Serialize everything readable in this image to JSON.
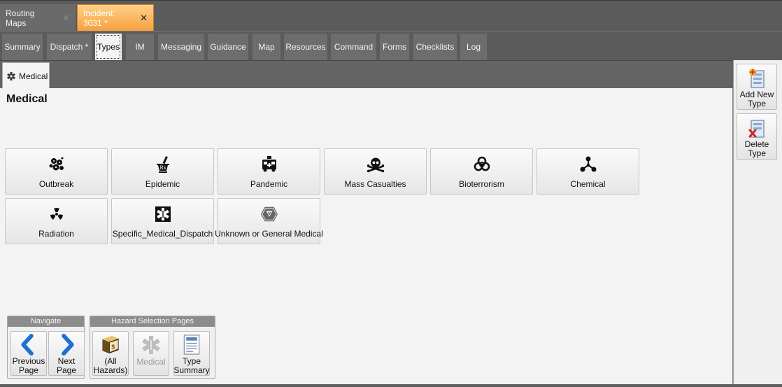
{
  "doc_tabs": [
    {
      "label": "Routing Maps",
      "close": "✕"
    },
    {
      "label": "Incident: 3031 *",
      "close": "✕"
    }
  ],
  "section_tabs": [
    "Summary",
    "Dispatch *",
    "Types",
    "IM",
    "Messaging",
    "Guidance",
    "Map",
    "Resources",
    "Command",
    "Forms",
    "Checklists",
    "Log"
  ],
  "type_tab": {
    "label": "Medical",
    "icon": "medical-star-icon"
  },
  "main": {
    "title": "Medical",
    "types": [
      {
        "label": "Outbreak",
        "icon": "outbreak-icon"
      },
      {
        "label": "Epidemic",
        "icon": "mortar-pestle-rx-icon"
      },
      {
        "label": "Pandemic",
        "icon": "ambulance-icon"
      },
      {
        "label": "Mass Casualties",
        "icon": "skull-crossbones-icon"
      },
      {
        "label": "Bioterrorism",
        "icon": "biohazard-icon"
      },
      {
        "label": "Chemical",
        "icon": "chemical-icon"
      },
      {
        "label": "Radiation",
        "icon": "radiation-icon"
      },
      {
        "label": "Specific_Medical_Dispatch",
        "icon": "star-of-life-icon"
      },
      {
        "label": "Unknown or General Medical",
        "icon": "hex-badge-icon"
      }
    ]
  },
  "side_panel": {
    "add_label": "Add New Type",
    "delete_label": "Delete Type"
  },
  "navigate": {
    "header": "Navigate",
    "previous_label": "Previous Page",
    "next_label": "Next Page"
  },
  "hazard_pages": {
    "header": "Hazard Selection Pages",
    "all_label": "(All Hazards)",
    "medical_label": "Medical",
    "summary_label": "Type Summary"
  },
  "colors": {
    "active_doc_tab": "#f7a03c",
    "nav_arrow": "#1e6fd0"
  }
}
